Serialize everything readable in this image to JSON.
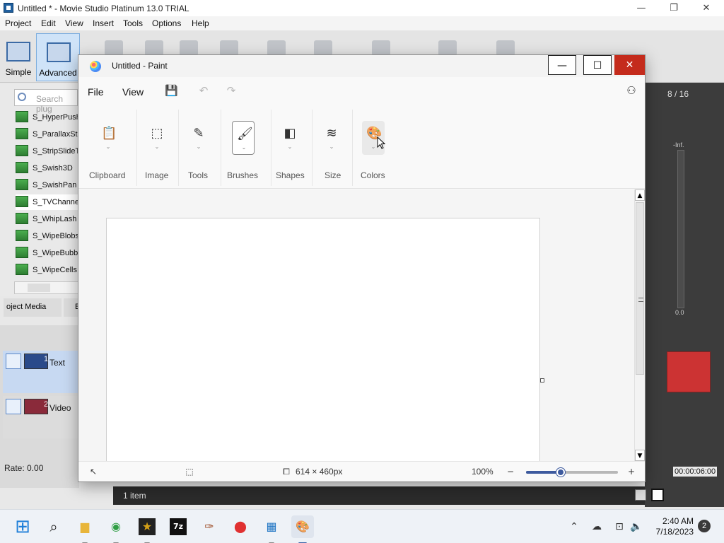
{
  "movie_studio": {
    "title": "Untitled * - Movie Studio Platinum 13.0 TRIAL",
    "window_controls": {
      "minimize": "—",
      "maximize": "❐",
      "close": "✕"
    },
    "menu": [
      "Project",
      "Edit",
      "View",
      "Insert",
      "Tools",
      "Options",
      "Help"
    ],
    "layout_buttons": {
      "simple": "Simple",
      "advanced": "Advanced"
    },
    "plugin_search_placeholder": "Search plug",
    "plugins": [
      "S_HyperPush",
      "S_ParallaxStr",
      "S_StripSlideTr",
      "S_Swish3D",
      "S_SwishPan",
      "S_TVChannel",
      "S_WhipLash",
      "S_WipeBlobs",
      "S_WipeBubble",
      "S_WipeCells"
    ],
    "selected_plugin": "S_TVChannel",
    "tabs": {
      "project_media": "oject Media",
      "other": "E"
    },
    "tracks": [
      {
        "number": "1",
        "label": "Text",
        "color": "#2a4a8a"
      },
      {
        "number": "2",
        "label": "Video",
        "color": "#8a2a3a"
      }
    ],
    "rate": "Rate: 0.00",
    "counter": "8 / 16",
    "meter_top": "-Inf.",
    "meter_bottom": "0.0",
    "timecode": "00:00:06:00",
    "item_count": "1 item"
  },
  "paint": {
    "title": "Untitled - Paint",
    "window_controls": {
      "minimize": "—",
      "maximize": "☐",
      "close": "✕"
    },
    "menu": {
      "file": "File",
      "view": "View"
    },
    "ribbon": [
      {
        "name": "clipboard",
        "label": "Clipboard",
        "icon": "clipboard-icon",
        "glyph": "📋"
      },
      {
        "name": "image",
        "label": "Image",
        "icon": "select-rectangle-icon",
        "glyph": "⬚"
      },
      {
        "name": "tools",
        "label": "Tools",
        "icon": "tools-icon",
        "glyph": "✎"
      },
      {
        "name": "brushes",
        "label": "Brushes",
        "icon": "brush-icon",
        "glyph": "🖌"
      },
      {
        "name": "shapes",
        "label": "Shapes",
        "icon": "shapes-icon",
        "glyph": "◧"
      },
      {
        "name": "size",
        "label": "Size",
        "icon": "line-size-icon",
        "glyph": "≋"
      },
      {
        "name": "colors",
        "label": "Colors",
        "icon": "palette-icon",
        "glyph": "🎨"
      }
    ],
    "canvas_size": "614 × 460px",
    "zoom": "100%",
    "zoom_level_fraction": 0.38
  },
  "taskbar": {
    "apps": [
      "start",
      "search",
      "file-explorer",
      "chrome",
      "movie-studio",
      "7zip",
      "paint-brush-app",
      "recorder",
      "video-editor",
      "paint"
    ],
    "time": "2:40 AM",
    "date": "7/18/2023",
    "notifications": "2"
  }
}
